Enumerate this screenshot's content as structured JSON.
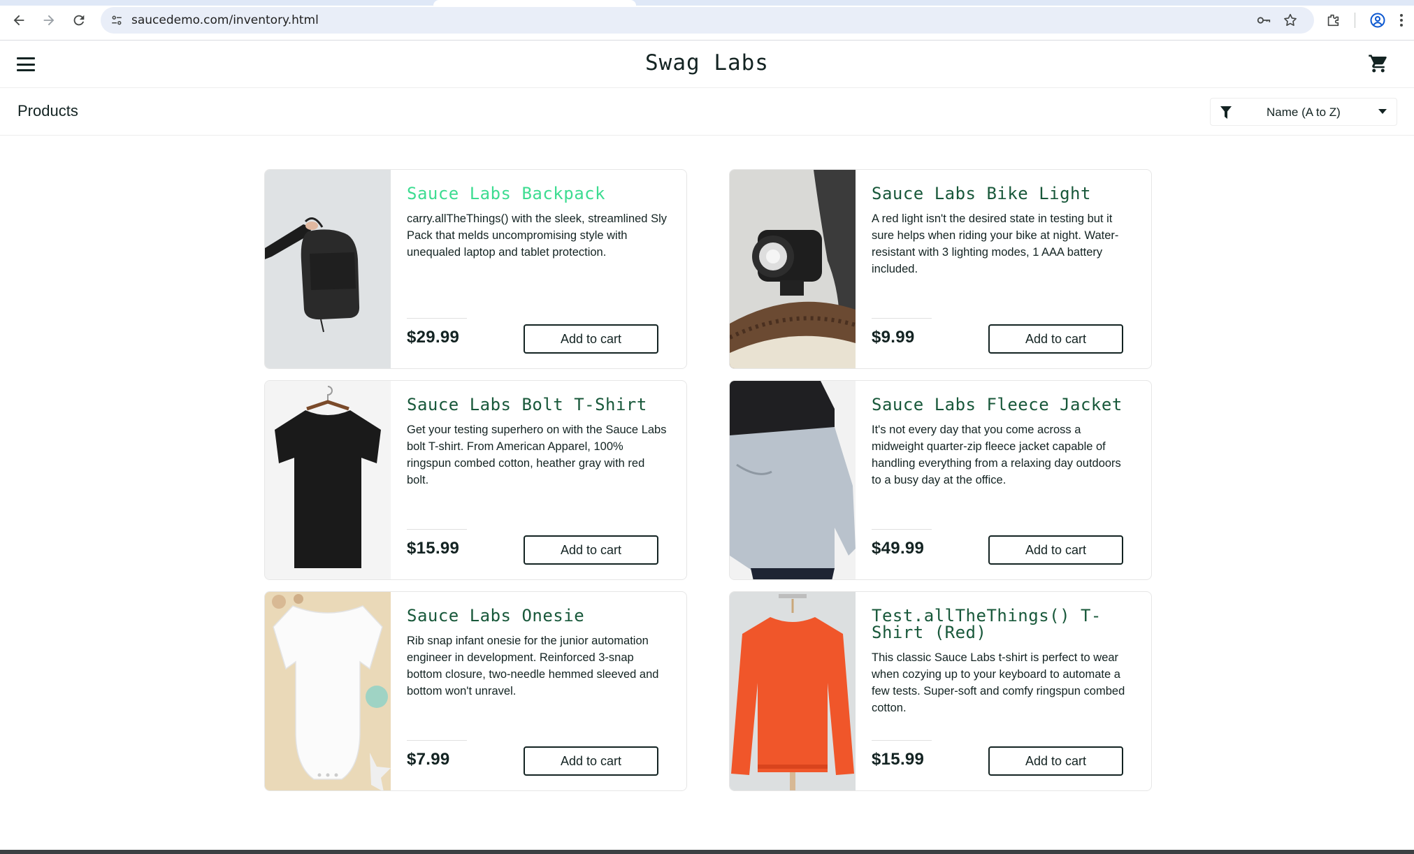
{
  "browser": {
    "url": "saucedemo.com/inventory.html",
    "icons": [
      "back-icon",
      "forward-icon",
      "reload-icon",
      "site-info-icon",
      "password-key-icon",
      "bookmark-star-icon",
      "extensions-icon",
      "profile-icon",
      "kebab-menu-icon"
    ]
  },
  "header": {
    "logo": "Swag Labs",
    "menu_icon": "hamburger-icon",
    "cart_icon": "cart-icon"
  },
  "subheader": {
    "title": "Products",
    "sort": {
      "selected": "Name (A to Z)",
      "icon": "filter-icon"
    }
  },
  "colors": {
    "product_name": "#18583a",
    "product_name_hover": "#3ddc91",
    "text": "#132322",
    "border": "#ededed"
  },
  "inventory": {
    "add_label": "Add to cart",
    "items": [
      {
        "name": "Sauce Labs Backpack",
        "description": "carry.allTheThings() with the sleek, streamlined Sly Pack that melds uncompromising style with unequaled laptop and tablet protection.",
        "price": "$29.99"
      },
      {
        "name": "Sauce Labs Bike Light",
        "description": "A red light isn't the desired state in testing but it sure helps when riding your bike at night. Water-resistant with 3 lighting modes, 1 AAA battery included.",
        "price": "$9.99"
      },
      {
        "name": "Sauce Labs Bolt T-Shirt",
        "description": "Get your testing superhero on with the Sauce Labs bolt T-shirt. From American Apparel, 100% ringspun combed cotton, heather gray with red bolt.",
        "price": "$15.99"
      },
      {
        "name": "Sauce Labs Fleece Jacket",
        "description": "It's not every day that you come across a midweight quarter-zip fleece jacket capable of handling everything from a relaxing day outdoors to a busy day at the office.",
        "price": "$49.99"
      },
      {
        "name": "Sauce Labs Onesie",
        "description": "Rib snap infant onesie for the junior automation engineer in development. Reinforced 3-snap bottom closure, two-needle hemmed sleeved and bottom won't unravel.",
        "price": "$7.99"
      },
      {
        "name": "Test.allTheThings() T-Shirt (Red)",
        "description": "This classic Sauce Labs t-shirt is perfect to wear when cozying up to your keyboard to automate a few tests. Super-soft and comfy ringspun combed cotton.",
        "price": "$15.99"
      }
    ]
  }
}
